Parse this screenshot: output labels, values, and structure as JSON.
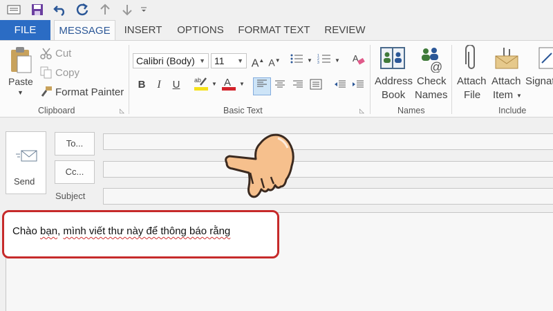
{
  "quick_access": {
    "icons": [
      "mail-icon",
      "save-icon",
      "undo-icon",
      "redo-icon",
      "up-arrow-icon",
      "down-arrow-icon",
      "customize-icon"
    ]
  },
  "tabs": {
    "file": "FILE",
    "message": "MESSAGE",
    "insert": "INSERT",
    "options": "OPTIONS",
    "format_text": "FORMAT TEXT",
    "review": "REVIEW"
  },
  "clipboard": {
    "paste": "Paste",
    "cut": "Cut",
    "copy": "Copy",
    "format_painter": "Format Painter",
    "group_label": "Clipboard"
  },
  "basic_text": {
    "font_name": "Calibri (Body)",
    "font_size": "11",
    "group_label": "Basic Text",
    "bold": "B",
    "italic": "I",
    "underline": "U",
    "highlight_color": "#f5e11a",
    "font_color": "#d3222a"
  },
  "names": {
    "address_book_line1": "Address",
    "address_book_line2": "Book",
    "check_names_line1": "Check",
    "check_names_line2": "Names",
    "group_label": "Names"
  },
  "include": {
    "attach_file_line1": "Attach",
    "attach_file_line2": "File",
    "attach_item_line1": "Attach",
    "attach_item_line2": "Item",
    "signature_line1": "Signat",
    "group_label": "Include"
  },
  "compose": {
    "send": "Send",
    "to": "To...",
    "cc": "Cc...",
    "subject": "Subject",
    "body_text_part1": "Chào ",
    "body_text_part2": "bạn",
    "body_text_part3": ", ",
    "body_text_part4": "mình viết thư này để thông báo rằng"
  },
  "colors": {
    "file_tab": "#2b6cc4",
    "active_tab_text": "#2b5797",
    "highlight_border": "#c62a2a"
  }
}
